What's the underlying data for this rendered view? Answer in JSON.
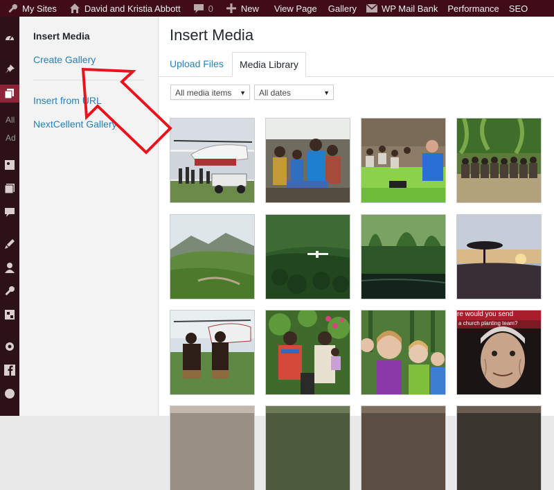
{
  "admin_bar": {
    "my_sites": "My Sites",
    "site_name": "David and Kristia Abbott",
    "comments_count": "0",
    "new_label": "New",
    "view_page": "View Page",
    "gallery": "Gallery",
    "wp_mail_bank": "WP Mail Bank",
    "performance": "Performance",
    "seo": "SEO"
  },
  "admin_menu": {
    "sub_item_1": "All",
    "sub_item_2": "Ad"
  },
  "media_menu": {
    "title": "Insert Media",
    "create_gallery": "Create Gallery",
    "insert_from_url": "Insert from URL",
    "nextcellent_gallery": "NextCellent Gallery"
  },
  "frame": {
    "title": "Insert Media",
    "tabs": [
      "Upload Files",
      "Media Library"
    ],
    "active_tab": "Media Library"
  },
  "filters": {
    "media_type": "All media items",
    "dates": "All dates"
  },
  "attachments": [
    "helicopter-crowd-photo",
    "airplane-passengers-photo",
    "presentation-meeting-photo",
    "village-group-photo",
    "mountain-valley-photo",
    "jungle-airstrip-photo",
    "rainforest-river-photo",
    "sunset-tree-photo",
    "helicopter-villagers-photo",
    "family-portrait-photo",
    "women-selfie-photo",
    "church-planting-team-photo"
  ],
  "overlay_text": {
    "line1": "re would you send",
    "line2": "a church planting team?"
  },
  "colors": {
    "admin_bar": "#3f0c18",
    "admin_menu": "#2c1218",
    "admin_menu_active": "#8c2336",
    "link": "#2680b5",
    "arrow": "#e8131d"
  }
}
